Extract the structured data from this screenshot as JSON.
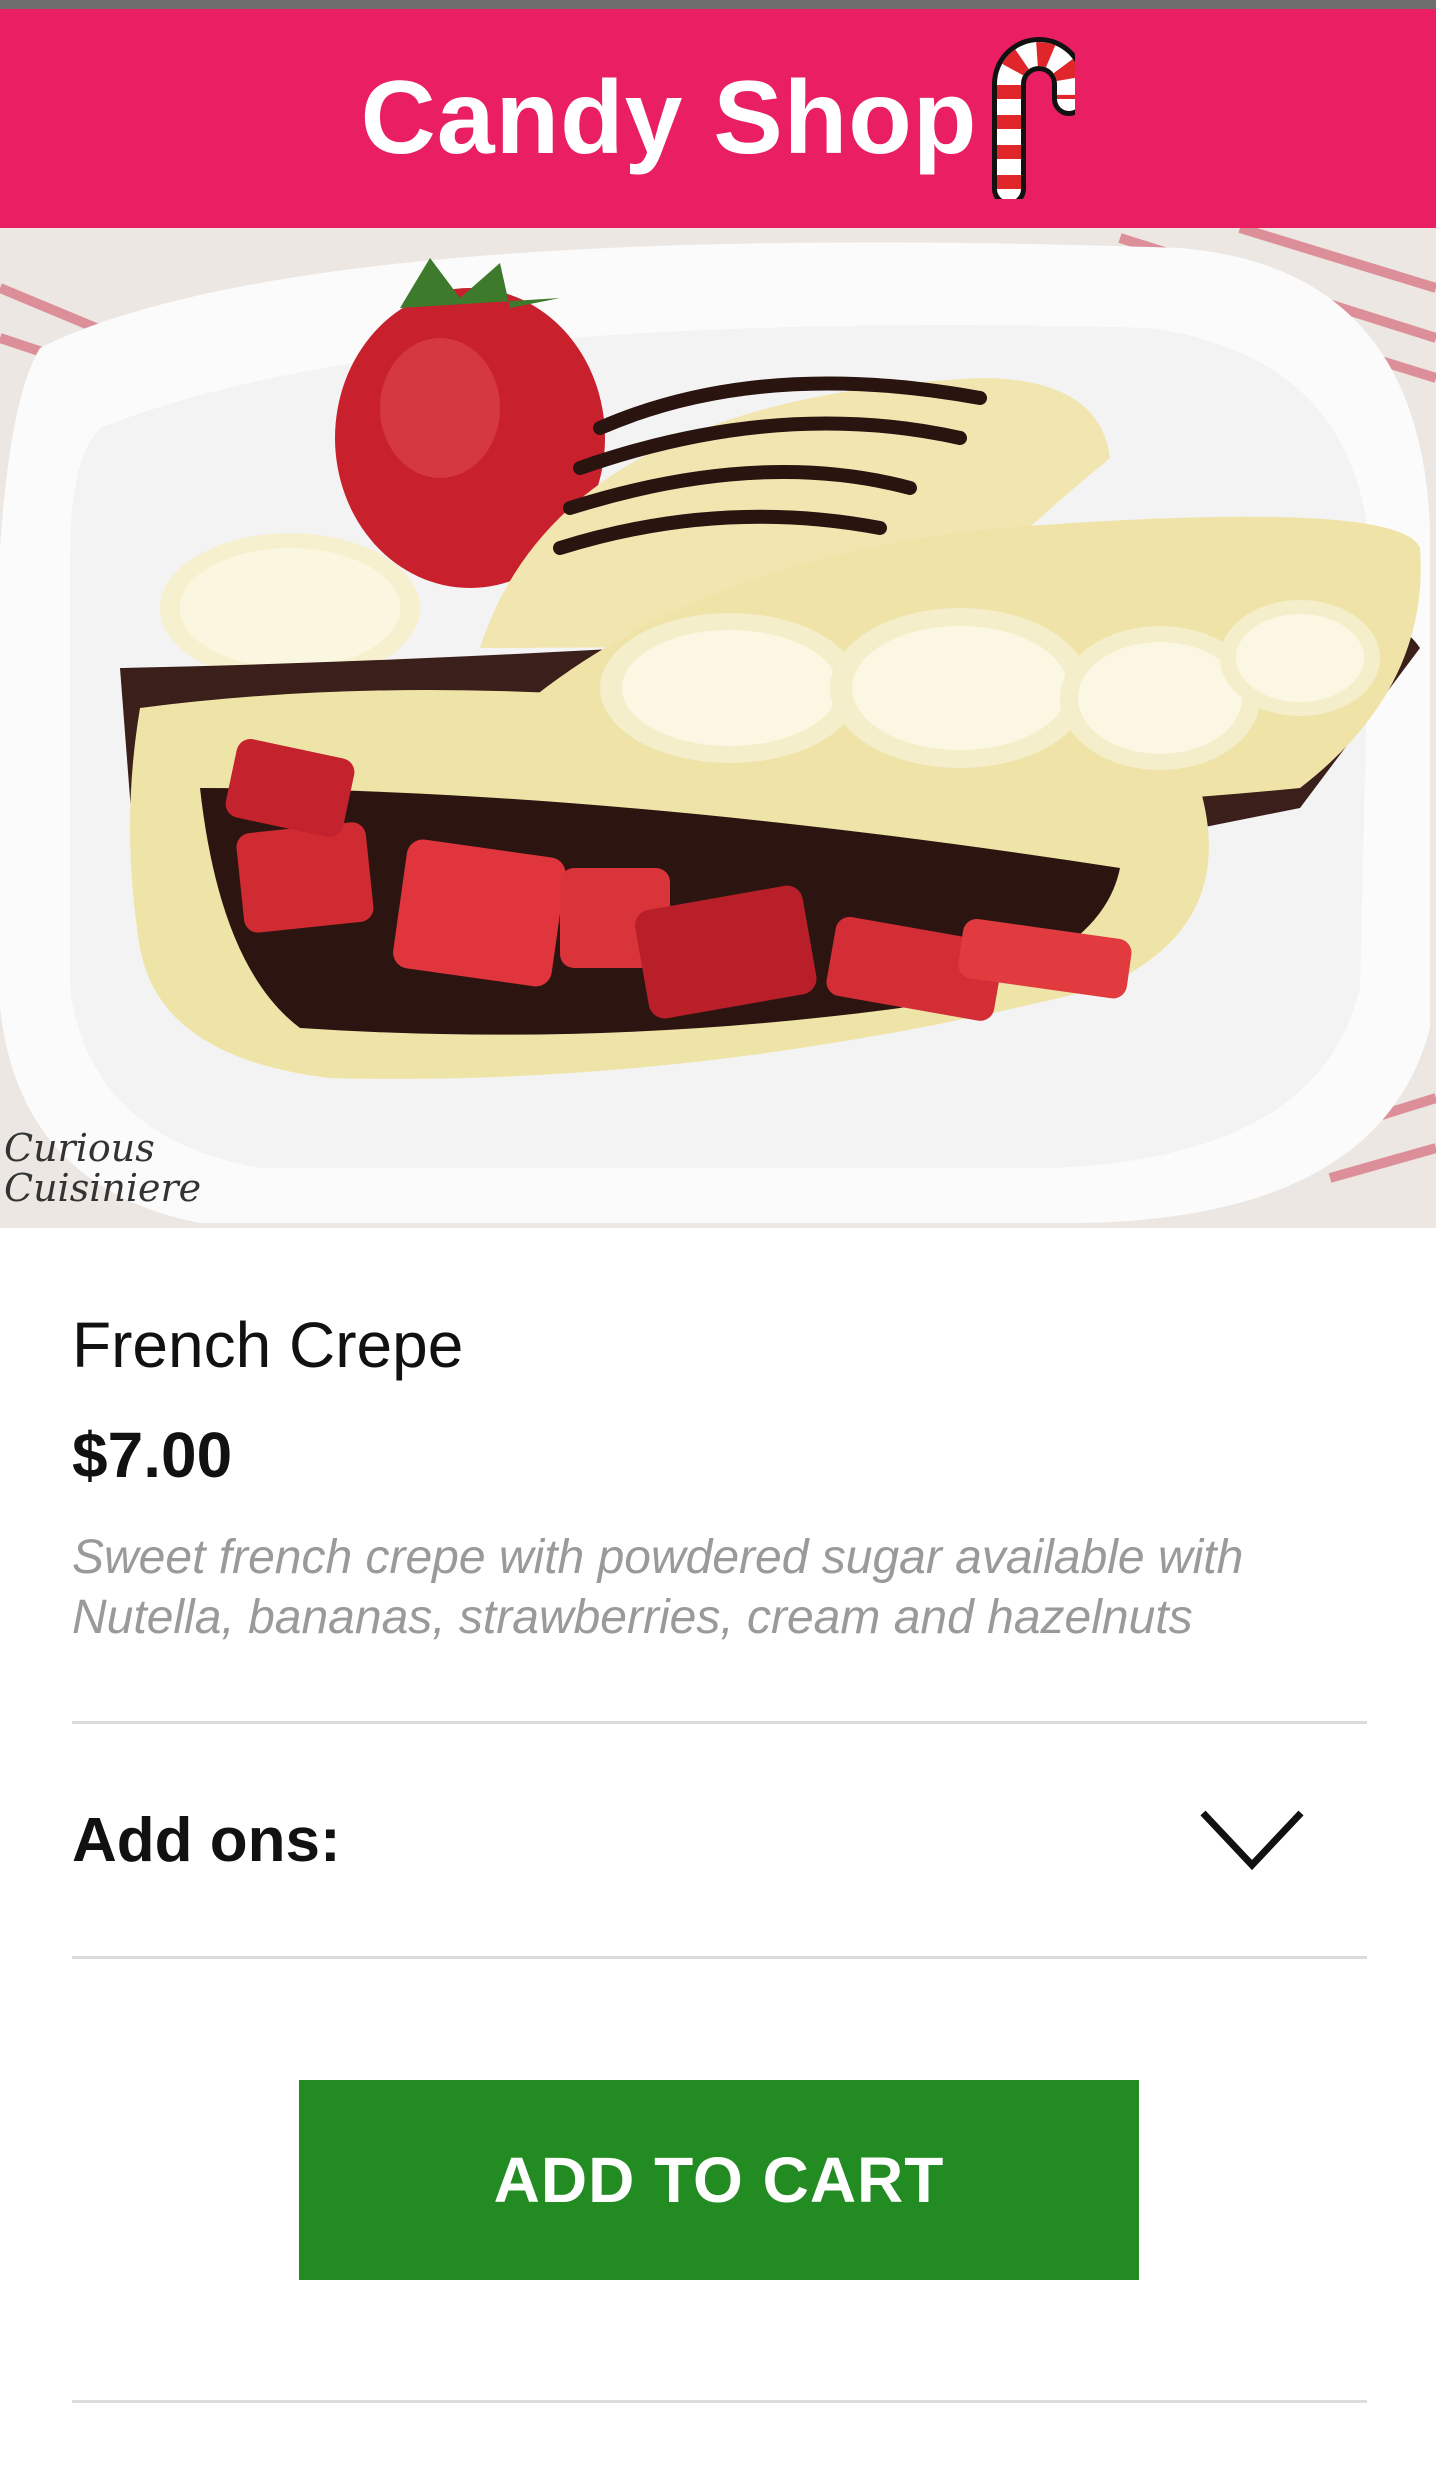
{
  "app_bar": {
    "title": "Candy Shop",
    "background_color": "#e91e63",
    "icon": "candy-cane-icon"
  },
  "product": {
    "image_watermark": [
      "Curious",
      "Cuisiniere"
    ],
    "name": "French Crepe",
    "price": "$7.00",
    "description": "Sweet french crepe with powdered sugar available with Nutella, bananas, strawberries, cream and hazelnuts"
  },
  "addons": {
    "label": "Add ons:",
    "icon": "chevron-down-icon"
  },
  "cart_button": {
    "label": "ADD TO CART",
    "background_color": "#228b22"
  }
}
